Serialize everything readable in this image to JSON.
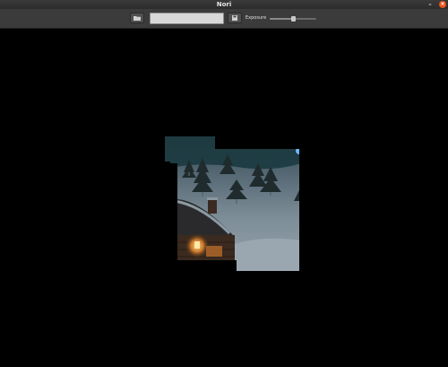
{
  "window": {
    "title": "Nori",
    "minimize_glyph": "–",
    "close_glyph": "×"
  },
  "toolbar": {
    "open_icon": "folder-icon",
    "filename_value": "",
    "save_icon": "save-icon",
    "exposure_label": "Exposure",
    "exposure_level": 0.5
  },
  "render": {
    "scene": "snowy cabin with pine trees at night",
    "status": "partially rendered"
  },
  "colors": {
    "titlebar": "#2c2c2c",
    "toolbar": "#3b3b3b",
    "close_button": "#e9541d",
    "background": "#000000"
  }
}
